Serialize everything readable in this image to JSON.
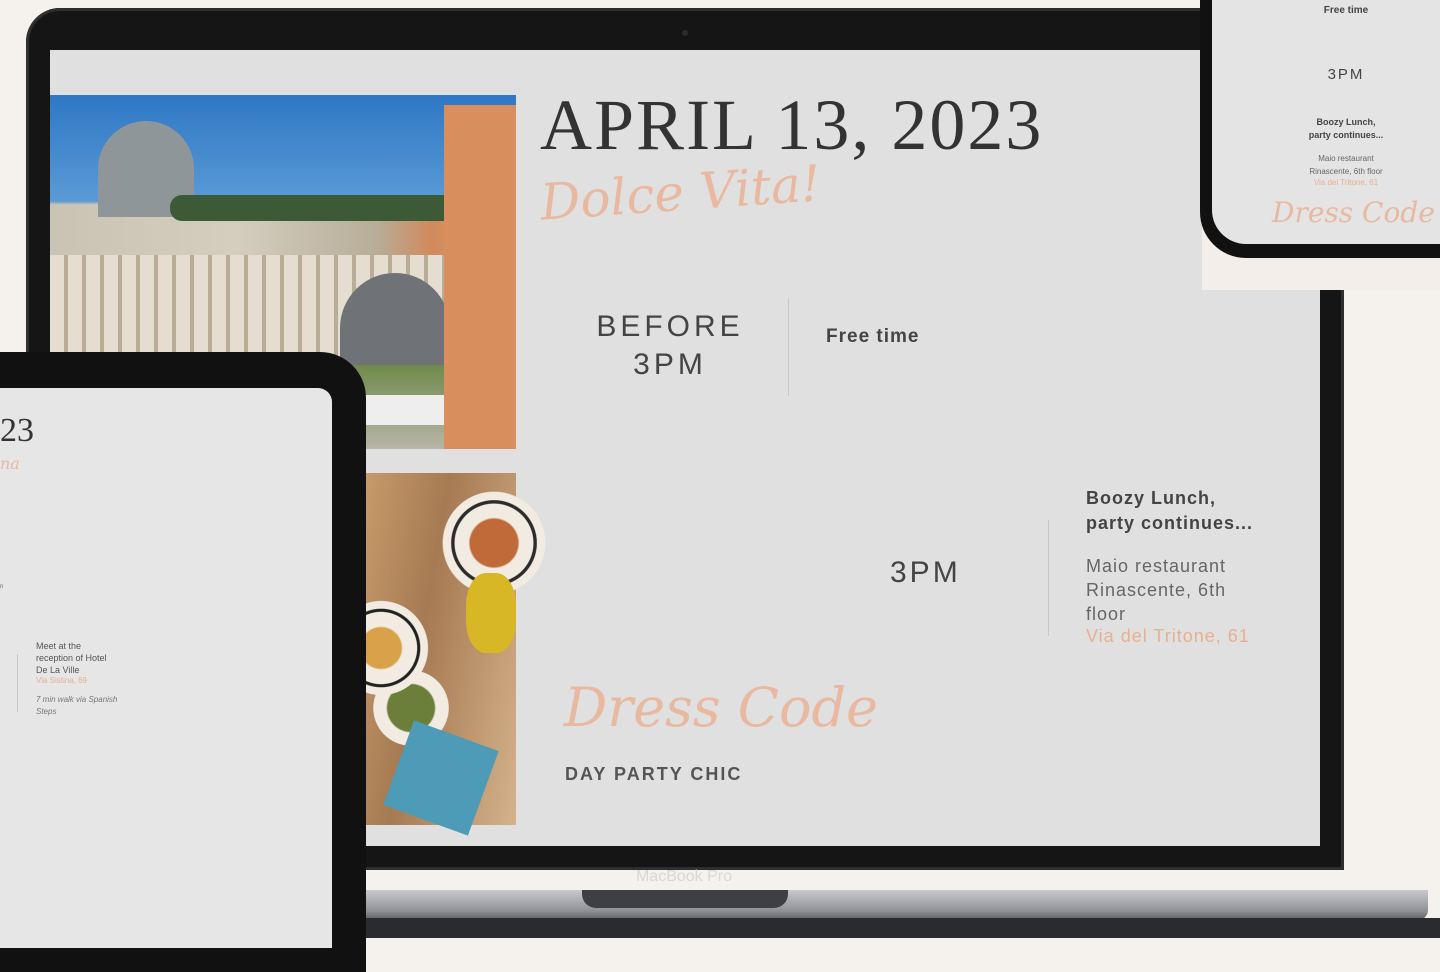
{
  "laptop": {
    "brand_label": "MacBook Pro",
    "screen": {
      "date_title": "APRIL 13, 2023",
      "script_title": "Dolce Vita!",
      "slot1": {
        "time_line1": "BEFORE",
        "time_line2": "3PM",
        "activity": "Free time"
      },
      "slot2": {
        "time": "3PM",
        "activity_line1": "Boozy Lunch,",
        "activity_line2": "party continues...",
        "place_line1": "Maio restaurant",
        "place_line2": "Rinascente, 6th",
        "place_line3": "floor",
        "address": "Via del Tritone, 61"
      },
      "dress_code_label": "Dress Code",
      "dress_code_value": "DAY PARTY CHIC"
    }
  },
  "tablet": {
    "year_fragment": "23",
    "script_fragment": "na",
    "meet_line1": "Meet at the",
    "meet_line2": "reception of Hotel",
    "meet_line3": "De La Ville",
    "address": "Via Sistina, 69",
    "walk_line1": "7 min walk via Spanish",
    "walk_line2": "Steps",
    "fragment_n": "n"
  },
  "phone": {
    "activity": "Free time",
    "time": "3PM",
    "lunch_line1": "Boozy Lunch,",
    "lunch_line2": "party continues...",
    "place_line1": "Maio restaurant",
    "place_line2": "Rinascente, 6th floor",
    "address": "Via del Tritone, 61",
    "dress_code_label": "Dress Code"
  },
  "colors": {
    "accent_peach": "#e7b091",
    "screen_bg": "#e0e0e0",
    "text_dark": "#444444"
  }
}
